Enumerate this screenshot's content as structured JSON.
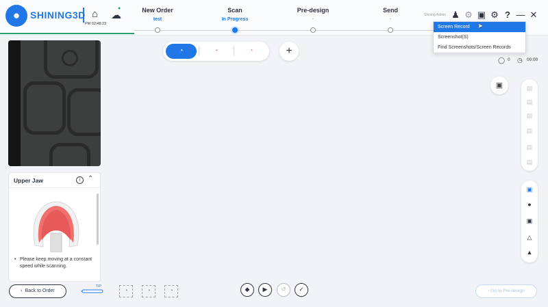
{
  "header": {
    "brand": "SHINING3D",
    "logo_icon": "tooth-logo",
    "home_time": "PM 02:48:23",
    "steps": [
      {
        "label": "New Order",
        "sub": "test",
        "active": false
      },
      {
        "label": "Scan",
        "sub": "In Progress",
        "active": true
      },
      {
        "label": "Pre-design",
        "sub": "-",
        "active": false
      },
      {
        "label": "Send",
        "sub": "-",
        "active": false
      }
    ],
    "user_label": "Shining Admin",
    "icons": [
      "user-icon",
      "settings-wheel-icon",
      "screenshot-icon",
      "gear-icon",
      "help-icon",
      "minimize-icon",
      "close-icon"
    ]
  },
  "dropdown": {
    "items": [
      "Screen Record",
      "Screenshot(S)",
      "Find Screenshots/Screen Records"
    ],
    "selected_index": 0
  },
  "jaw_panel": {
    "title": "Upper Jaw",
    "note": "Please keep moving at a constant speed while scanning."
  },
  "counters": {
    "count": "0",
    "time": "00:00"
  },
  "bottom": {
    "back_label": "Back to Order",
    "probe_label": "TIP",
    "next_label": "Go to Pre-design"
  },
  "colors": {
    "accent": "#1f78e6",
    "progress_green": "#2aa36b"
  }
}
